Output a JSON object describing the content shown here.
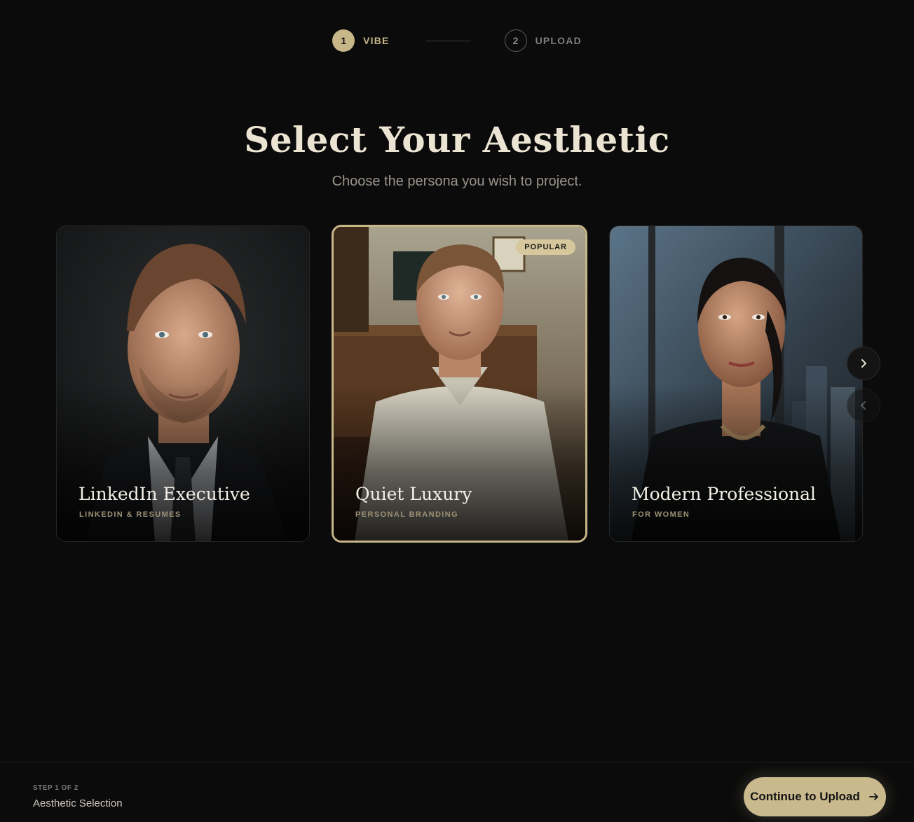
{
  "stepper": {
    "steps": [
      {
        "number": "1",
        "label": "VIBE",
        "state": "active"
      },
      {
        "number": "2",
        "label": "UPLOAD",
        "state": "inactive"
      }
    ]
  },
  "header": {
    "title": "Select Your Aesthetic",
    "subtitle": "Choose the persona you wish to project."
  },
  "cards": [
    {
      "title": "LinkedIn Executive",
      "subtitle": "LINKEDIN & RESUMES",
      "selected": false
    },
    {
      "title": "Quiet Luxury",
      "subtitle": "PERSONAL BRANDING",
      "selected": true,
      "badge": "POPULAR"
    },
    {
      "title": "Modern Professional",
      "subtitle": "FOR WOMEN",
      "selected": false
    }
  ],
  "carousel": {
    "next_icon": "chevron-right-icon",
    "prev_icon": "chevron-left-icon"
  },
  "footer": {
    "step_text": "STEP 1 OF 2",
    "step_name": "Aesthetic Selection",
    "continue_label": "Continue to Upload",
    "continue_icon": "arrow-right-icon"
  },
  "colors": {
    "accent": "#c7b688",
    "background": "#0b0b0b"
  }
}
